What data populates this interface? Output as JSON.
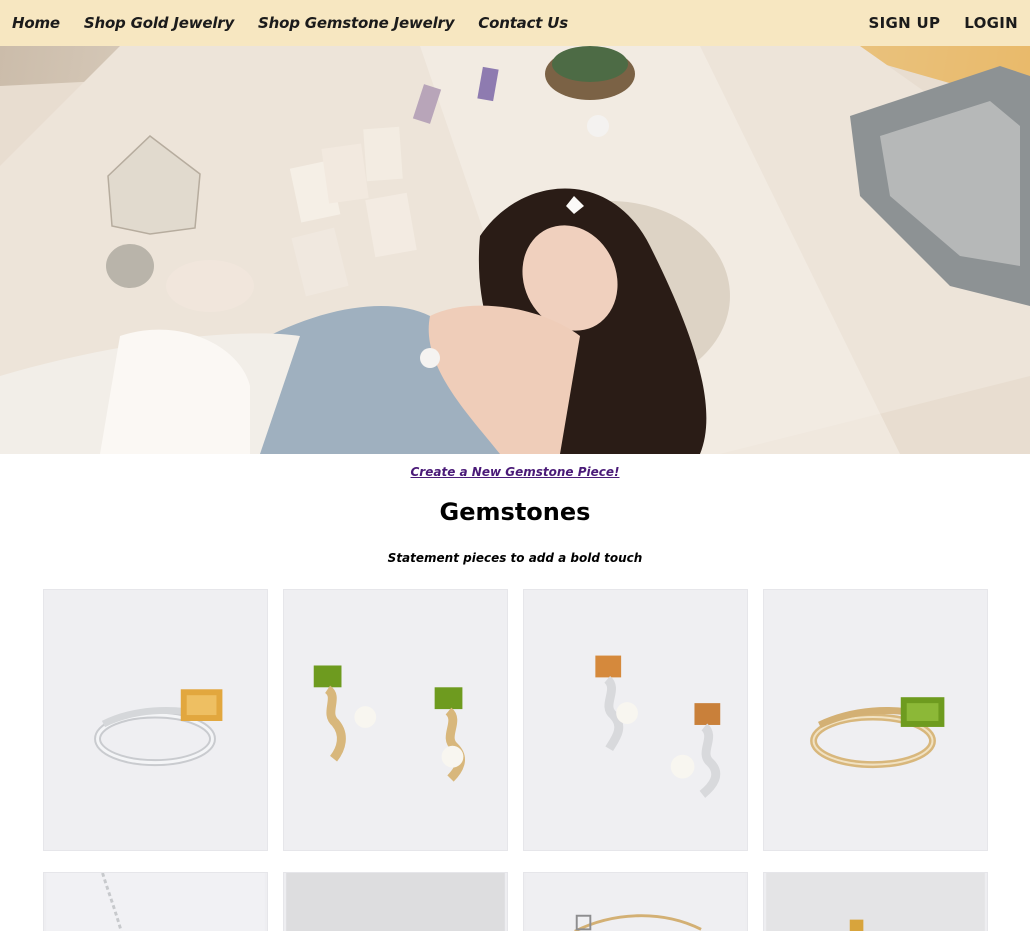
{
  "nav": {
    "left_links": [
      "Home",
      "Shop Gold Jewelry",
      "Shop Gemstone Jewelry",
      "Contact Us"
    ],
    "right_links": [
      "SIGN UP",
      "LOGIN"
    ],
    "background": "#f7e7c1"
  },
  "hero": {
    "description_icon": "hero-lifestyle-photo"
  },
  "create_link": "Create a New Gemstone Piece!",
  "page_title": "Gemstones",
  "page_subtitle": "Statement pieces to add a bold touch",
  "products": [
    {
      "image": "citrine-silver-wrap-ring"
    },
    {
      "image": "peridot-pearl-gold-drop-earrings"
    },
    {
      "image": "citrine-pearl-silver-drop-earrings"
    },
    {
      "image": "peridot-gold-wrap-ring"
    },
    {
      "image": "silver-chain-necklace"
    },
    {
      "image": "gray-product-photo"
    },
    {
      "image": "gold-chain-bracelet"
    },
    {
      "image": "gold-gemstone-piece"
    }
  ],
  "colors": {
    "link": "#4a1a78",
    "card_bg": "#eeeef1"
  }
}
